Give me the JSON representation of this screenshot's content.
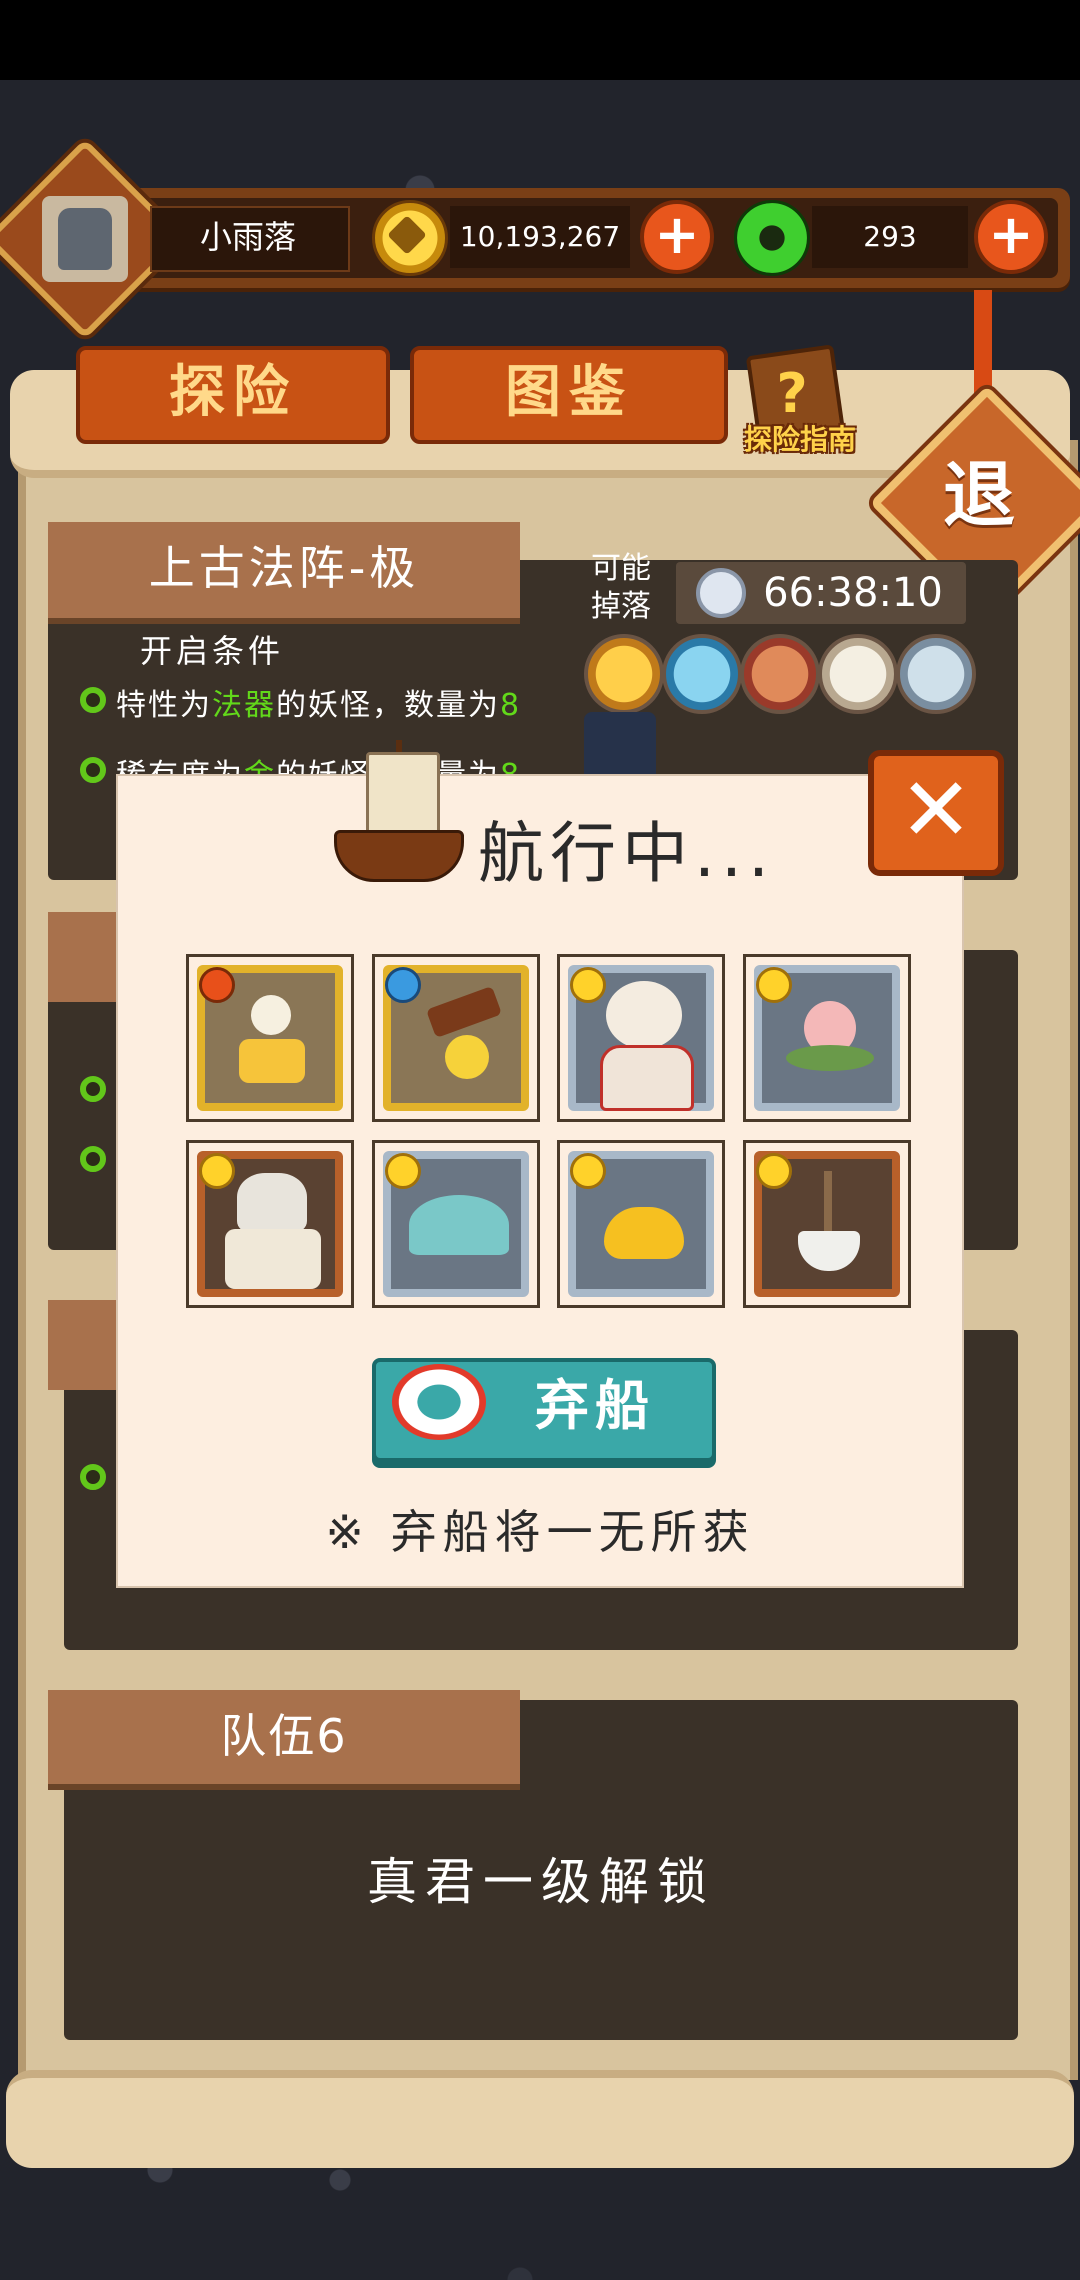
{
  "player": {
    "name": "小雨落"
  },
  "currency": {
    "gold": "10,193,267",
    "jade": "293"
  },
  "tabs": [
    "探险",
    "图鉴"
  ],
  "guide_label": "探险指南",
  "exit_label": "退",
  "expedition": {
    "title": "上古法阵-极",
    "open_conditions_label": "开启条件",
    "condition1": {
      "prefix": "特性为",
      "highlight": "法器",
      "middle": "的妖怪，数量为",
      "count": "8"
    },
    "condition2": {
      "prefix": "稀有度为",
      "highlight": "金",
      "middle": "的妖怪，数量为",
      "count": "8"
    },
    "drop_label": "可能掉落",
    "timer": "66:38:10"
  },
  "team6": {
    "title": "队伍6",
    "unlock_text": "真君一级解锁"
  },
  "popup": {
    "title": "航行中...",
    "abandon_button": "弃船",
    "note": "※ 弃船将一无所获",
    "slots": [
      {
        "frame": "gold",
        "element": "fire-icon",
        "item": "gold-ingot-doll"
      },
      {
        "frame": "gold",
        "element": "water-icon",
        "item": "cannon-chick"
      },
      {
        "frame": "blue",
        "element": "sun-icon",
        "item": "fox-girl"
      },
      {
        "frame": "blue",
        "element": "sun-icon",
        "item": "peach"
      },
      {
        "frame": "brown",
        "element": "sun-icon",
        "item": "armored-knight"
      },
      {
        "frame": "blue",
        "element": "sun-icon",
        "item": "bat"
      },
      {
        "frame": "blue",
        "element": "sun-icon",
        "item": "gold-ingot"
      },
      {
        "frame": "brown",
        "element": "sun-icon",
        "item": "incense-burner"
      }
    ]
  }
}
